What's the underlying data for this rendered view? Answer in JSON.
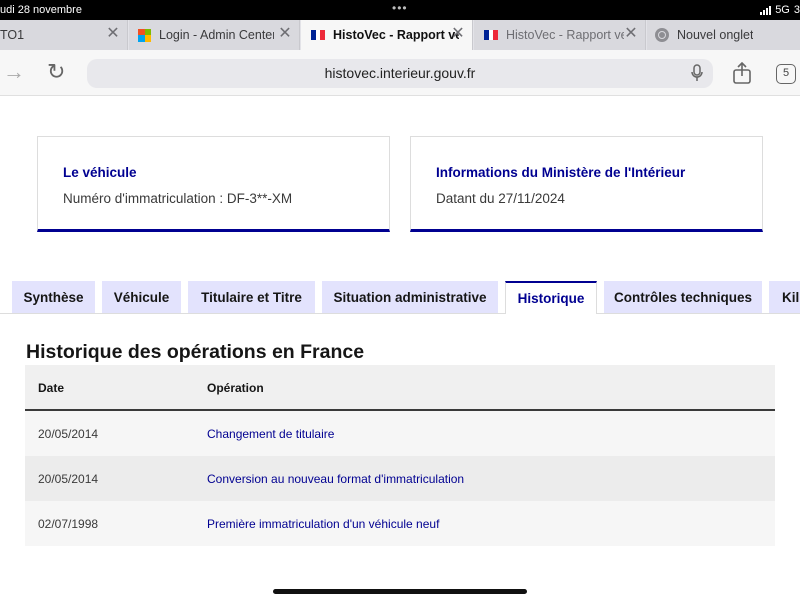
{
  "status": {
    "date": "udi 28 novembre",
    "network": "5G",
    "battery": "3"
  },
  "browser": {
    "tabs": [
      {
        "title": "TO1",
        "favicon": "none",
        "active": false
      },
      {
        "title": "Login - Admin Center",
        "favicon": "office-logo-icon",
        "active": false
      },
      {
        "title": "HistoVec - Rapport ve",
        "favicon": "france-flag-icon",
        "active": true
      },
      {
        "title": "HistoVec - Rapport ve",
        "favicon": "france-flag-icon",
        "active": false
      },
      {
        "title": "Nouvel onglet",
        "favicon": "globe-icon",
        "active": false
      }
    ],
    "url": "histovec.interieur.gouv.fr",
    "tab_count": "5"
  },
  "cards": {
    "vehicle": {
      "heading": "Le véhicule",
      "value": "Numéro d'immatriculation : DF-3**-XM"
    },
    "ministry": {
      "heading": "Informations du Ministère de l'Intérieur",
      "value": "Datant du 27/11/2024"
    }
  },
  "page_tabs": [
    {
      "label": "Synthèse",
      "active": false
    },
    {
      "label": "Véhicule",
      "active": false
    },
    {
      "label": "Titulaire et Titre",
      "active": false
    },
    {
      "label": "Situation administrative",
      "active": false
    },
    {
      "label": "Historique",
      "active": true
    },
    {
      "label": "Contrôles techniques",
      "active": false
    },
    {
      "label": "Kil",
      "active": false
    }
  ],
  "history": {
    "title": "Historique des opérations en France",
    "columns": {
      "date": "Date",
      "operation": "Opération"
    },
    "rows": [
      {
        "date": "20/05/2014",
        "operation": "Changement de titulaire"
      },
      {
        "date": "20/05/2014",
        "operation": "Conversion au nouveau format d'immatriculation"
      },
      {
        "date": "02/07/1998",
        "operation": "Première immatriculation d'un véhicule neuf"
      }
    ]
  },
  "colors": {
    "accent": "#000091",
    "tab_inactive_bg": "#e3e3fd"
  }
}
